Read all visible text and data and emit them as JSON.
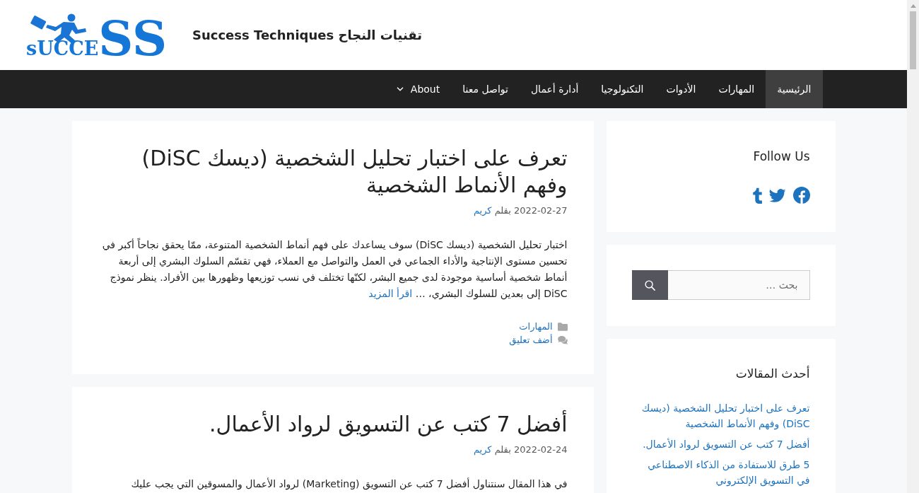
{
  "header": {
    "logo": {
      "text_small": "sUCCE",
      "text_large": "SS"
    },
    "site_title": "تقنيات النجاح Success Techniques"
  },
  "nav": {
    "items": [
      {
        "label": "الرئيسية",
        "selected": true,
        "dropdown": false
      },
      {
        "label": "المهارات",
        "selected": false,
        "dropdown": false
      },
      {
        "label": "الأدوات",
        "selected": false,
        "dropdown": false
      },
      {
        "label": "التكنولوجيا",
        "selected": false,
        "dropdown": false
      },
      {
        "label": "أدارة أعمال",
        "selected": false,
        "dropdown": false
      },
      {
        "label": "تواصل معنا",
        "selected": false,
        "dropdown": false
      },
      {
        "label": "About",
        "selected": false,
        "dropdown": true
      }
    ]
  },
  "posts": [
    {
      "title": "تعرف على اختبار تحليل الشخصية (ديسك DiSC) وفهم الأنماط الشخصية",
      "date": "2022-02-27",
      "byline": "بقلم",
      "author": "كريم",
      "excerpt": "اختبار تحليل الشخصية (ديسك DiSC) سوف يساعدك على فهم أنماط الشخصية المتنوعة، ممّا يحقق نجاحاً أكبر في تحسين مستوى الإنتاجية والأداء الجماعي في العمل والتواصل مع العملاء، فهي تقسّم السلوك البشري إلى أربعة أنماط شخصية أساسية موجودة لدى جميع البشر، لكنّها تختلف في نسب توزيعها وظهورها بين الأفراد. ينظر نموذج DiSC إلى بعدين للسلوك البشري، …",
      "read_more": "اقرأ المزيد",
      "category": "المهارات",
      "comments": "أضف تعليق"
    },
    {
      "title": "أفضل 7 كتب عن التسويق لرواد الأعمال.",
      "date": "2022-02-24",
      "byline": "بقلم",
      "author": "كريم",
      "excerpt": "في هذا المقال سنتناول أفضل 7 كتب عن التسويق (Marketing) لرواد الأعمال والمسوقين التي يجب عليك"
    }
  ],
  "sidebar": {
    "follow": {
      "title": "Follow Us"
    },
    "search": {
      "placeholder": "بحث …"
    },
    "recent_posts": {
      "title": "أحدث المقالات",
      "items": [
        "تعرف على اختبار تحليل الشخصية (ديسك DiSC) وفهم الأنماط الشخصية",
        "أفضل 7 كتب عن التسويق لرواد الأعمال.",
        "5 طرق للاستفادة من الذكاء الاصطناعي في التسويق الإلكتروني"
      ]
    }
  }
}
